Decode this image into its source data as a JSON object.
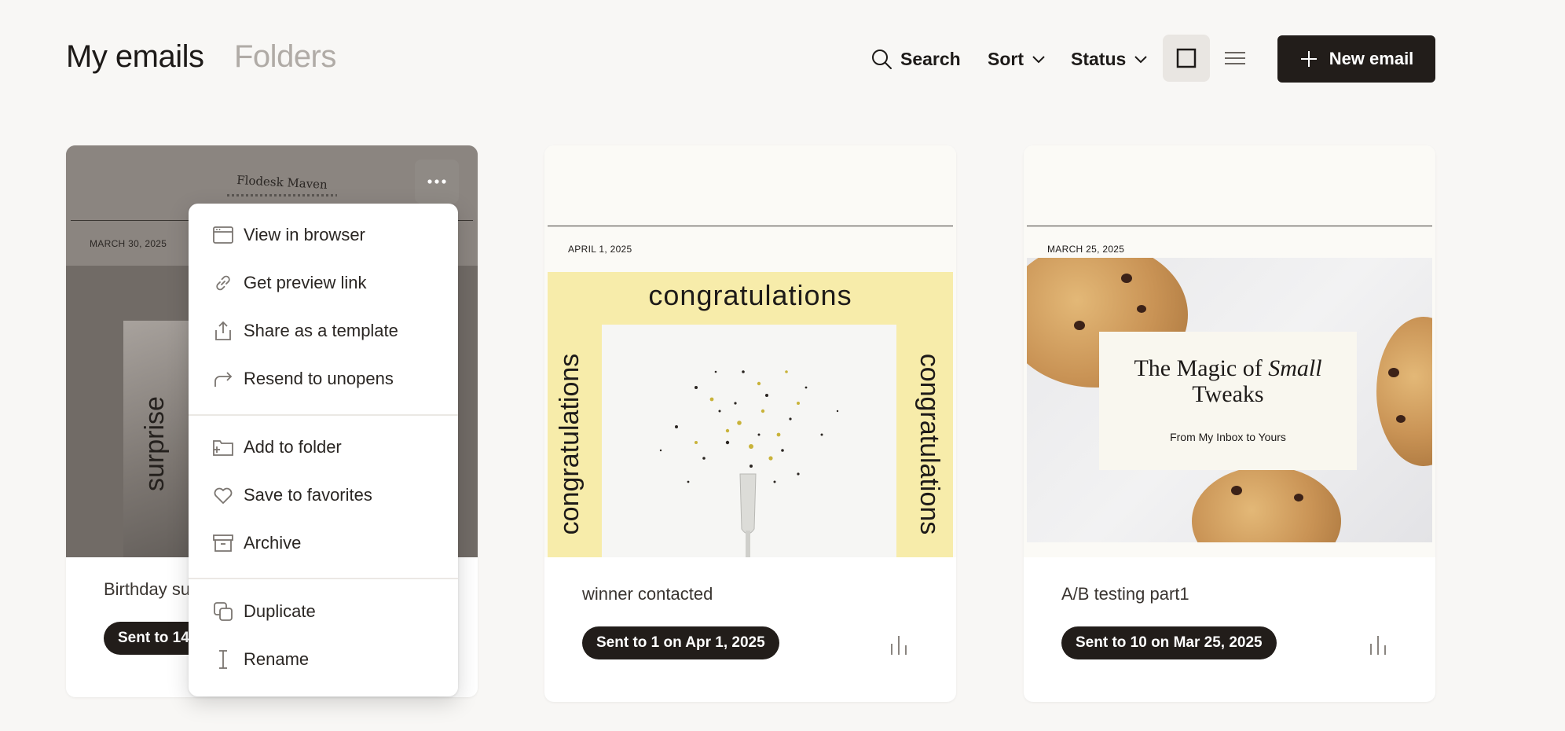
{
  "header": {
    "tab_active": "My emails",
    "tab_inactive": "Folders",
    "search_label": "Search",
    "sort_label": "Sort",
    "status_label": "Status",
    "new_email_label": "New email"
  },
  "cards": [
    {
      "title": "Birthday su",
      "badge": "Sent to 147",
      "preview": {
        "logo": "Flodesk Maven",
        "date": "MARCH 30, 2025",
        "vertical_text": "surprise"
      }
    },
    {
      "title": "winner contacted",
      "badge": "Sent to 1 on Apr 1, 2025",
      "preview": {
        "date": "APRIL 1, 2025",
        "headline": "congratulations",
        "vertical_left": "congratulations",
        "vertical_right": "congratulations"
      }
    },
    {
      "title": "A/B testing part1",
      "badge": "Sent to 10 on Mar 25, 2025",
      "preview": {
        "date": "MARCH 25, 2025",
        "headline_line1": "The Magic of",
        "headline_italic": "Small",
        "headline_line2": "Tweaks",
        "subline": "From My Inbox to Yours"
      }
    }
  ],
  "menu": {
    "items": [
      {
        "label": "View in browser",
        "icon": "browser-window-icon"
      },
      {
        "label": "Get preview link",
        "icon": "link-icon"
      },
      {
        "label": "Share as a template",
        "icon": "share-upload-icon"
      },
      {
        "label": "Resend to unopens",
        "icon": "resend-arrow-icon"
      },
      {
        "label": "Add to folder",
        "icon": "folder-plus-icon"
      },
      {
        "label": "Save to favorites",
        "icon": "heart-icon"
      },
      {
        "label": "Archive",
        "icon": "archive-box-icon"
      },
      {
        "label": "Duplicate",
        "icon": "duplicate-icon"
      },
      {
        "label": "Rename",
        "icon": "text-cursor-icon"
      }
    ]
  }
}
